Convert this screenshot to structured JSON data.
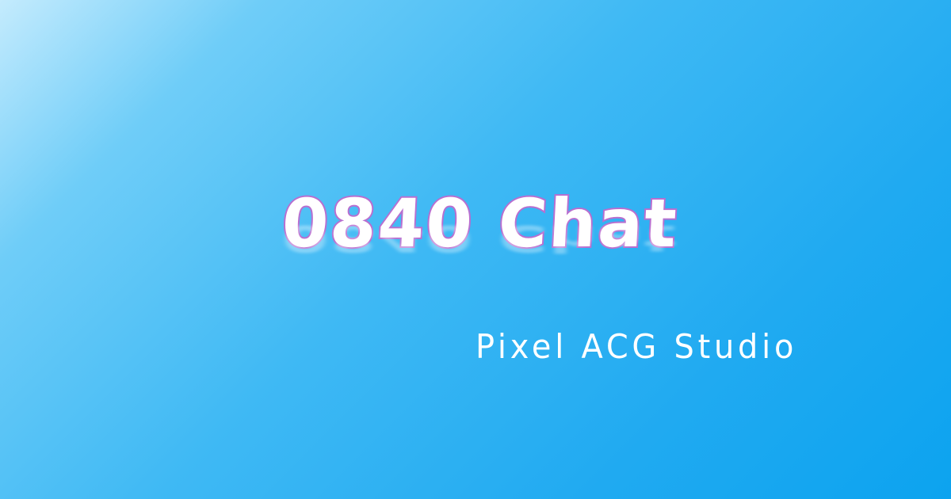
{
  "brand": {
    "title": "0840 Chat",
    "studio": "Pixel ACG Studio"
  },
  "colors": {
    "background_top_left": "#c4ebfd",
    "background_bottom_right": "#0ca3ef",
    "title_fill": "#ffffff",
    "title_outline": "#b86fd0",
    "studio_text": "#ffffff"
  }
}
